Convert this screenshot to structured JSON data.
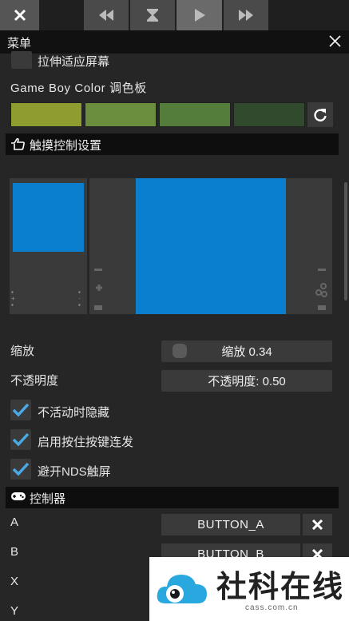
{
  "toolbar": {
    "buttons": [
      {
        "name": "close",
        "icon": "close-icon"
      },
      {
        "name": "rewind",
        "icon": "rewind-icon"
      },
      {
        "name": "hourglass",
        "icon": "hourglass-icon"
      },
      {
        "name": "play",
        "icon": "play-icon"
      },
      {
        "name": "fast-forward",
        "icon": "fast-forward-icon"
      }
    ]
  },
  "menu": {
    "title": "菜单"
  },
  "stretch": {
    "label": "拉伸适应屏幕"
  },
  "palette": {
    "label": "Game Boy Color 调色板",
    "swatches": [
      "#8f9c2f",
      "#6a8d3e",
      "#547c3a",
      "#31492d"
    ],
    "reset_icon": "refresh-icon"
  },
  "touch_section": {
    "title": "触摸控制设置",
    "icon": "hand-pointer-icon"
  },
  "preview": {
    "screen_color": "#0a7fd0"
  },
  "scale": {
    "label": "缩放",
    "slider_text": "缩放 0.34",
    "value": 0.34
  },
  "opacity": {
    "label": "不透明度",
    "slider_text": "不透明度: 0.50",
    "value": 0.5
  },
  "checks": [
    {
      "label": "不活动时隐藏",
      "checked": true
    },
    {
      "label": "启用按住按键连发",
      "checked": true
    },
    {
      "label": "避开NDS触屏",
      "checked": true
    }
  ],
  "controller_section": {
    "title": "控制器",
    "icon": "gamepad-icon"
  },
  "bindings": [
    {
      "key": "A",
      "value": "BUTTON_A"
    },
    {
      "key": "B",
      "value": "BUTTON_B"
    },
    {
      "key": "X",
      "value": ""
    },
    {
      "key": "Y",
      "value": ""
    }
  ],
  "watermark": {
    "brand": "社科在线",
    "domain": "cass.com.cn"
  },
  "colors": {
    "accent": "#0a7fd0",
    "check": "#49a8e6"
  }
}
